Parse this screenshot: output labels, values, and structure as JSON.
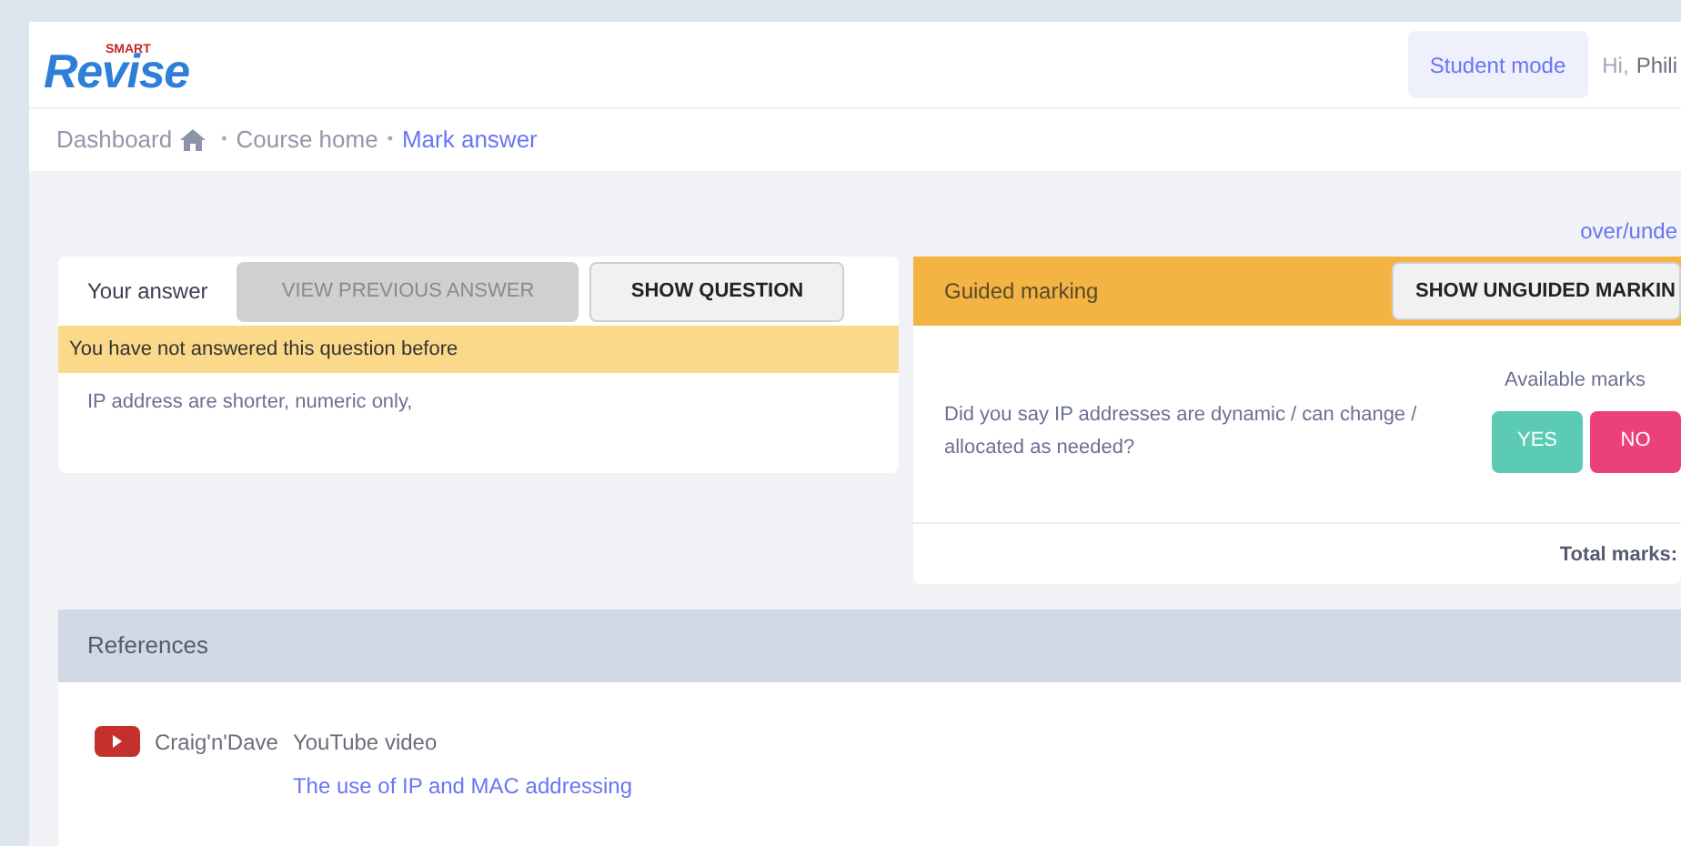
{
  "logo": {
    "small": "SMART",
    "main": "Revise"
  },
  "header": {
    "mode_button": "Student mode",
    "greeting": "Hi,",
    "user": "Phili"
  },
  "breadcrumb_separator": "•",
  "breadcrumb": [
    {
      "label": "Dashboard",
      "kind": "home",
      "current": false
    },
    {
      "label": "Course home",
      "kind": "plain",
      "current": false
    },
    {
      "label": "Mark answer",
      "kind": "plain",
      "current": true
    }
  ],
  "top_link": "over/unde",
  "answer_panel": {
    "title": "Your answer",
    "buttons": [
      {
        "label": "VIEW PREVIOUS ANSWER",
        "disabled": true
      },
      {
        "label": "SHOW QUESTION",
        "disabled": false
      }
    ],
    "notice": "You have not answered this question before",
    "answer": "IP address are shorter, numeric only,"
  },
  "marking_panel": {
    "title": "Guided marking",
    "button": "SHOW UNGUIDED MARKIN",
    "available_label": "Available marks",
    "question": "Did you say IP addresses are dynamic / can change / allocated as needed?",
    "choices": [
      {
        "label": "YES",
        "color": "#5bcbb5"
      },
      {
        "label": "NO",
        "color": "#ec407a"
      }
    ],
    "total_label": "Total marks:"
  },
  "references": {
    "title": "References",
    "items": [
      {
        "author": "Craig'n'Dave",
        "type": "YouTube video",
        "link": "The use of IP and MAC addressing"
      }
    ]
  }
}
